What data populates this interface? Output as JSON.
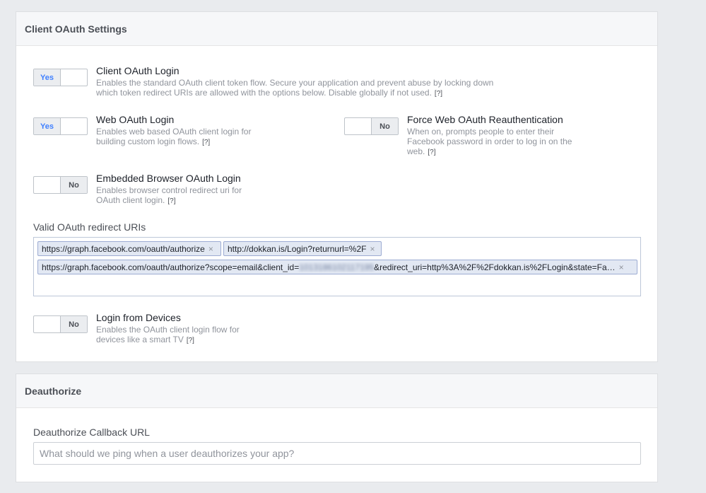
{
  "oauth_panel": {
    "title": "Client OAuth Settings",
    "client_oauth_login": {
      "title": "Client OAuth Login",
      "desc_line1": "Enables the standard OAuth client token flow. Secure your application and prevent abuse by locking down",
      "desc_line2": "which token redirect URIs are allowed with the options below. Disable globally if not used.",
      "toggle": "Yes"
    },
    "web_oauth_login": {
      "title": "Web OAuth Login",
      "desc_line1": "Enables web based OAuth client login for",
      "desc_line2": "building custom login flows.",
      "toggle": "Yes"
    },
    "force_reauth": {
      "title": "Force Web OAuth Reauthentication",
      "desc_line1": "When on, prompts people to enter their",
      "desc_line2": "Facebook password in order to log in on the",
      "desc_line3": "web.",
      "toggle": "No"
    },
    "embedded_browser": {
      "title": "Embedded Browser OAuth Login",
      "desc_line1": "Enables browser control redirect uri for",
      "desc_line2": "OAuth client login.",
      "toggle": "No"
    },
    "redirect_uris": {
      "label": "Valid OAuth redirect URIs",
      "tokens": [
        "https://graph.facebook.com/oauth/authorize",
        "http://dokkan.is/Login?returnurl=%2F"
      ],
      "long_token_prefix": "https://graph.facebook.com/oauth/authorize?scope=email&client_id=",
      "long_token_hidden": "1013186102117195",
      "long_token_suffix": "&redirect_uri=http%3A%2F%2Fdokkan.is%2FLogin&state=Fa…"
    },
    "login_devices": {
      "title": "Login from Devices",
      "desc_line1": "Enables the OAuth client login flow for",
      "desc_line2": "devices like a smart TV",
      "toggle": "No"
    },
    "help_mark": "[?]",
    "remove_mark": "×"
  },
  "deauth_panel": {
    "title": "Deauthorize",
    "callback_label": "Deauthorize Callback URL",
    "callback_placeholder": "What should we ping when a user deauthorizes your app?",
    "callback_value": ""
  }
}
